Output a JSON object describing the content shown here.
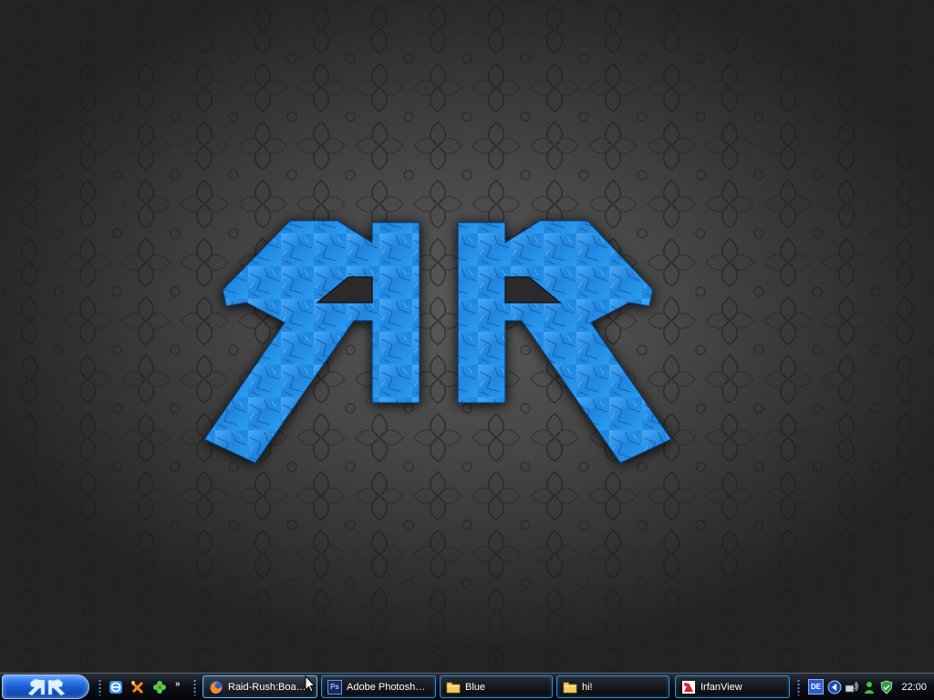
{
  "taskbar": {
    "start_button": {
      "logo_text": "RR"
    },
    "quick_launch": {
      "icons": [
        "ie-icon",
        "tool-icon",
        "clover-icon"
      ],
      "more_label": "»"
    },
    "tasks": [
      {
        "label": "Raid-Rush:Boa…",
        "icon": "firefox-icon",
        "active": true
      },
      {
        "label": "Adobe Photosh…",
        "icon": "photoshop-icon",
        "icon_text": "Ps"
      },
      {
        "label": "Blue",
        "icon": "folder-icon"
      },
      {
        "label": "hi!",
        "icon": "folder-icon"
      },
      {
        "label": "IrfanView",
        "icon": "irfanview-icon"
      }
    ],
    "tray": {
      "language": "DE",
      "icons": [
        "media-back-icon",
        "network-icon",
        "messenger-icon",
        "shield-icon"
      ],
      "clock": "22:00"
    }
  },
  "desktop": {
    "wallpaper_logo": "RR",
    "colors": {
      "logo_blue": "#2a8fe6",
      "background": "#3c3c3c",
      "taskbar_accent": "#2a8fd6"
    }
  }
}
